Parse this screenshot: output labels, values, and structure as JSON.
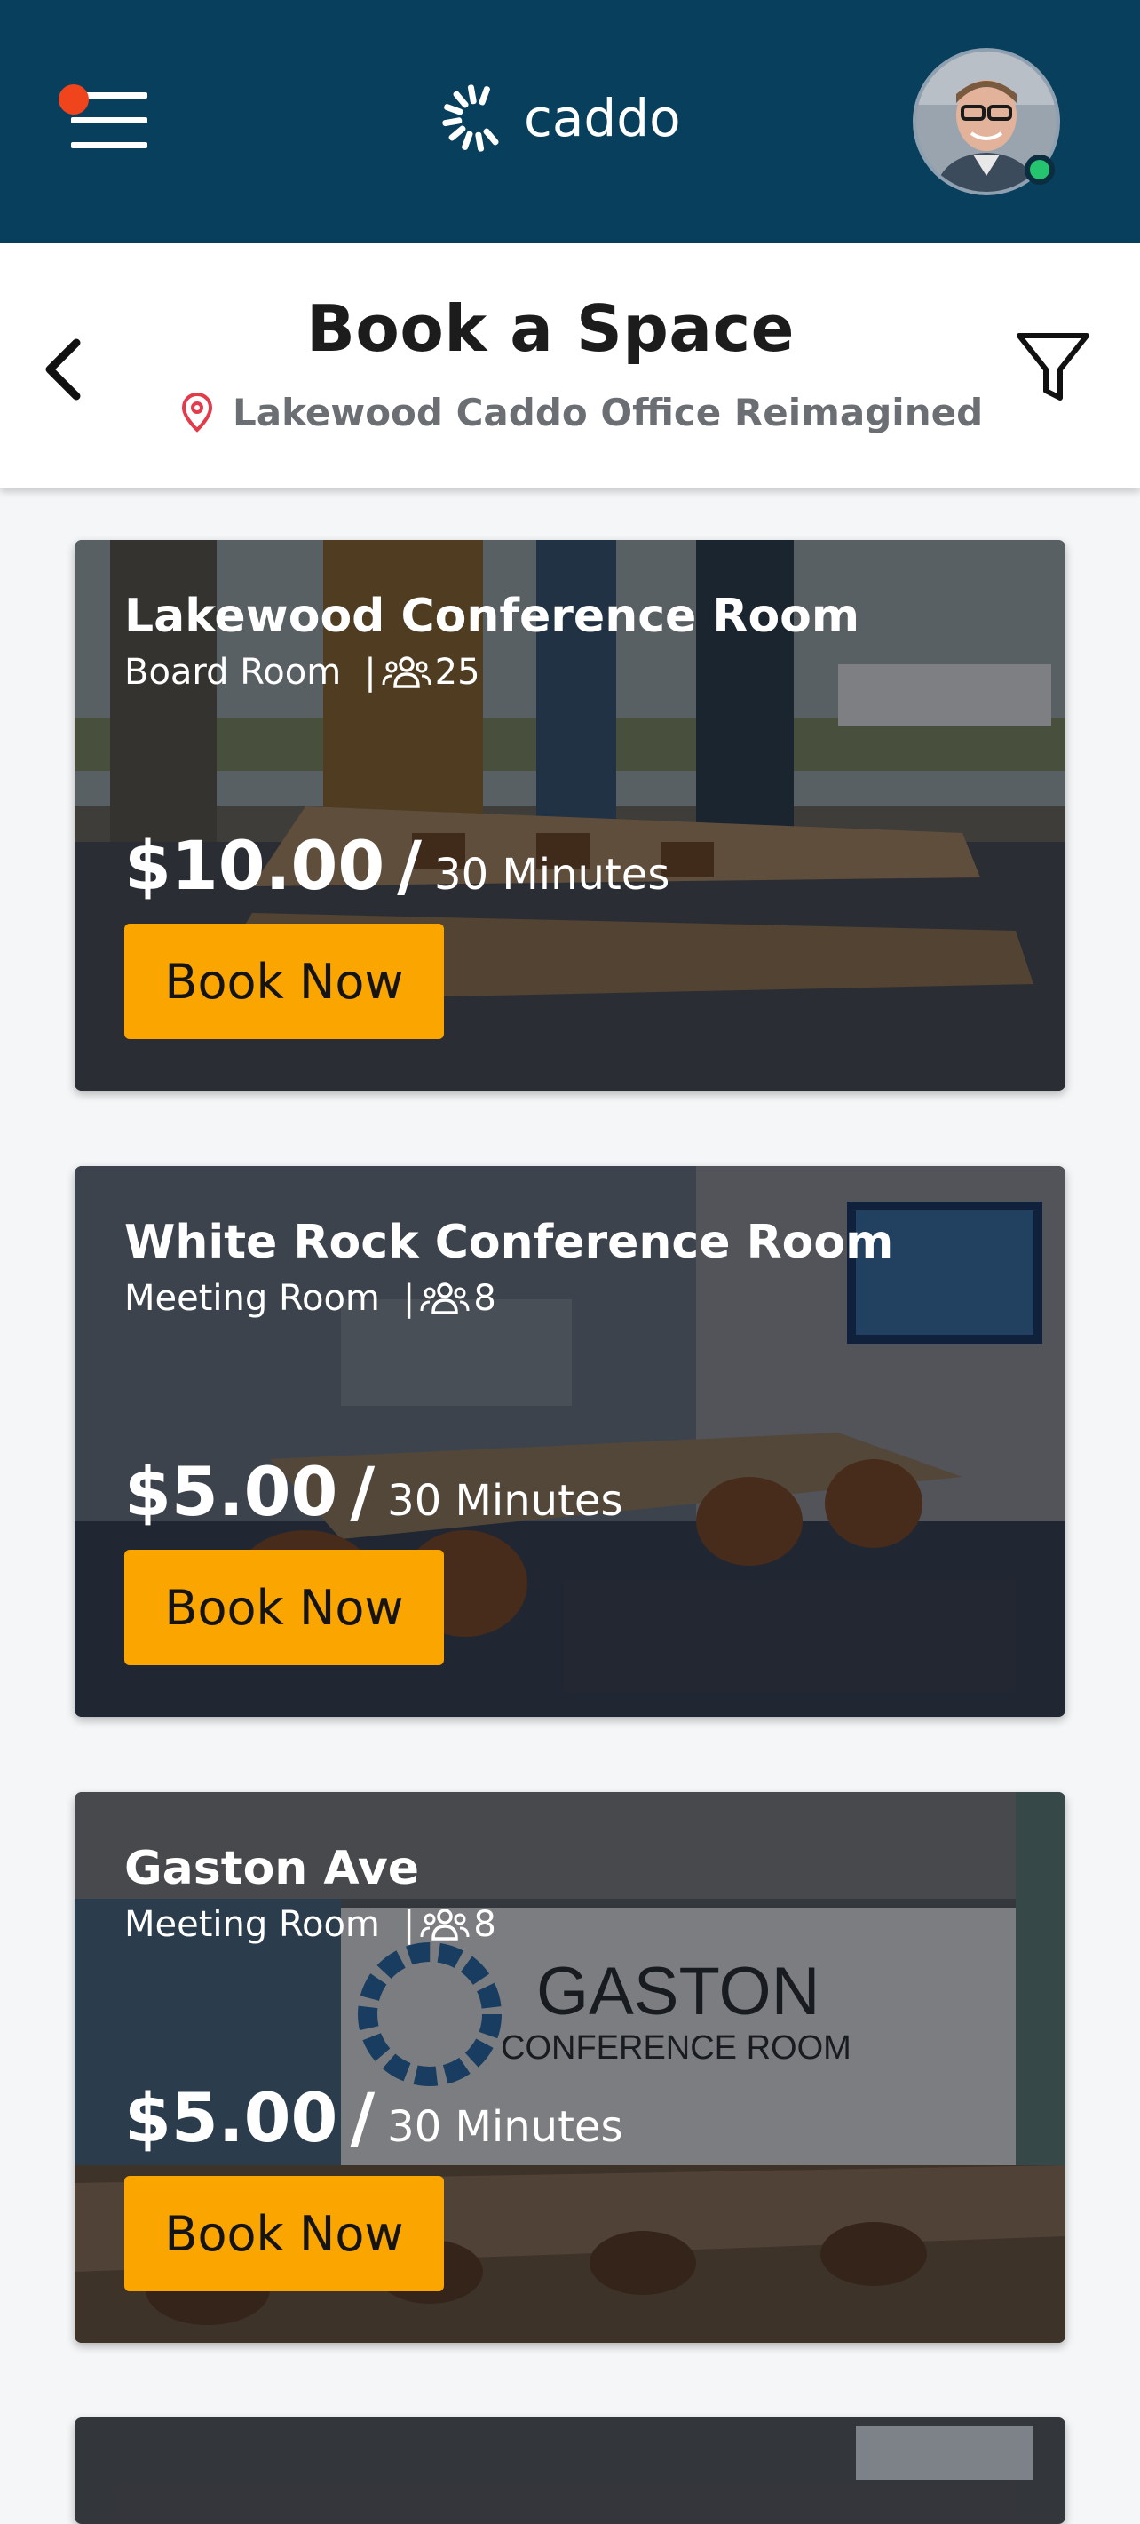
{
  "header": {
    "logo_text": "caddo",
    "menu_icon": "hamburger-menu-icon",
    "notification_color": "#f0441c",
    "brand_color": "#073f5c",
    "avatar_status": "online",
    "avatar_status_color": "#25c46e"
  },
  "subheader": {
    "title": "Book a Space",
    "location": "Lakewood Caddo Office Reimagined",
    "back_icon": "chevron-left-icon",
    "filter_icon": "filter-icon",
    "location_icon": "map-pin-icon",
    "location_icon_color": "#e23b4c"
  },
  "spaces": [
    {
      "name": "Lakewood Conference Room",
      "type": "Board Room",
      "separator": "|",
      "capacity": "25",
      "price": "$10.00",
      "slash": "/",
      "duration": "30 Minutes",
      "button_label": "Book Now"
    },
    {
      "name": "White Rock Conference Room",
      "type": "Meeting Room",
      "separator": "|",
      "capacity": "8",
      "price": "$5.00",
      "slash": "/",
      "duration": "30 Minutes",
      "button_label": "Book Now"
    },
    {
      "name": "Gaston Ave",
      "type": "Meeting Room",
      "separator": "|",
      "capacity": "8",
      "price": "$5.00",
      "slash": "/",
      "duration": "30 Minutes",
      "button_label": "Book Now"
    }
  ],
  "button_color": "#fba500"
}
